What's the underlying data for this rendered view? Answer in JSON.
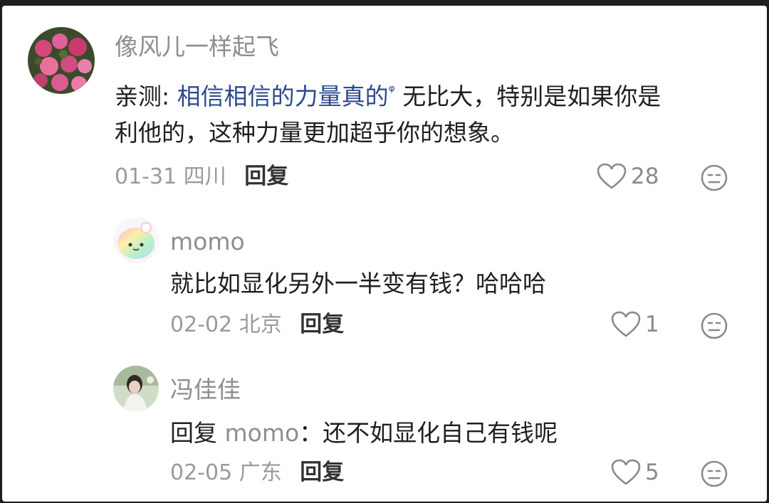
{
  "comments": [
    {
      "username": "像风儿一样起飞",
      "prefix": "亲测:",
      "link": "相信相信的力量真的",
      "search_mark": "ᵠ",
      "text_line1": "无比大，特别是如果你是",
      "text_line2": "利他的，这种力量更加超乎你的想象。",
      "date": "01-31",
      "location": "四川",
      "reply_label": "回复",
      "likes": "28"
    },
    {
      "username": "momo",
      "text": "就比如显化另外一半变有钱？哈哈哈",
      "date": "02-02",
      "location": "北京",
      "reply_label": "回复",
      "likes": "1"
    },
    {
      "username": "冯佳佳",
      "reply_prefix": "回复",
      "reply_to": "momo",
      "text": "：还不如显化自己有钱呢",
      "date": "02-05",
      "location": "广东",
      "reply_label": "回复",
      "likes": "5"
    }
  ],
  "icons": {
    "like": "heart-outline-icon",
    "dislike": "neutral-face-icon"
  },
  "colors": {
    "link": "#2a4a8a",
    "muted": "#8e8e8e",
    "text": "#1f1f1f"
  }
}
